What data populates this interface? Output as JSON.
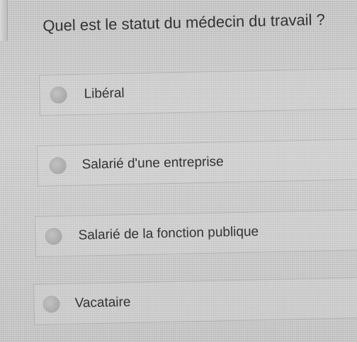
{
  "question": {
    "text": "Quel est le statut du médecin du travail ?"
  },
  "options": [
    {
      "label": "Libéral",
      "selected": false
    },
    {
      "label": "Salarié d'une entreprise",
      "selected": false
    },
    {
      "label": "Salarié de la fonction publique",
      "selected": false
    },
    {
      "label": "Vacataire",
      "selected": false
    }
  ]
}
